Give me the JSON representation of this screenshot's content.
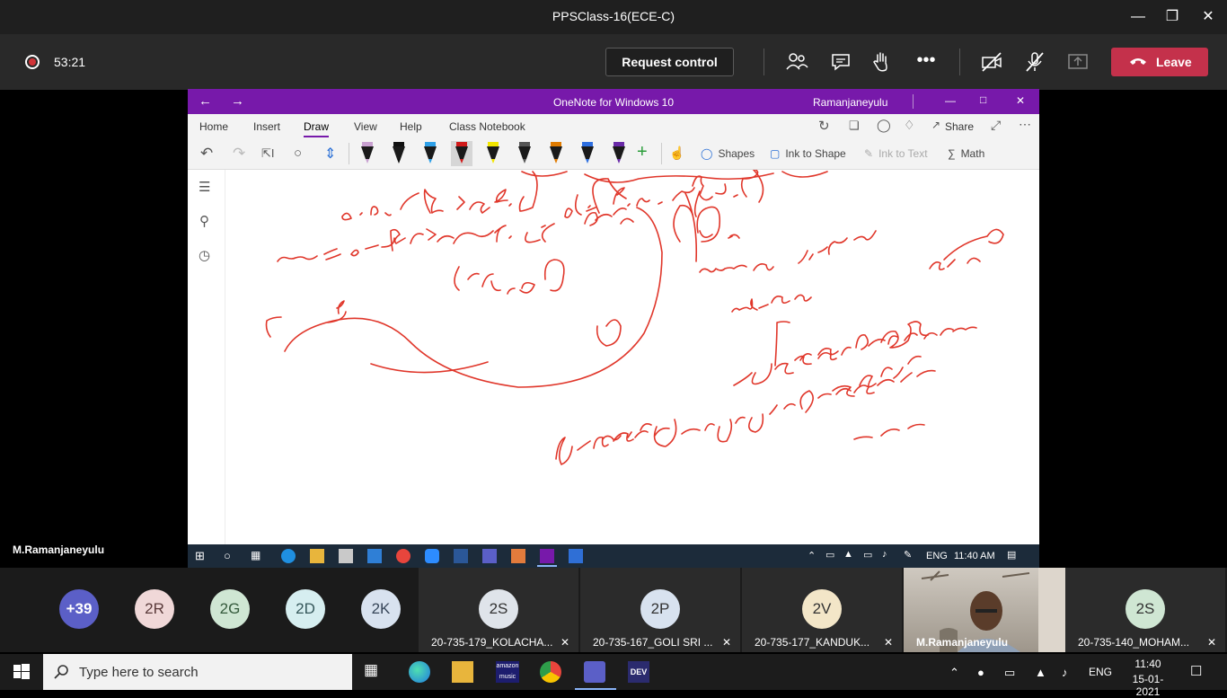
{
  "teams": {
    "window_title": "PPSClass-16(ECE-C)",
    "timer": "53:21",
    "request_control": "Request control",
    "leave": "Leave"
  },
  "onenote": {
    "title": "OneNote for Windows 10",
    "user": "Ramanjaneyulu",
    "tabs": [
      "Home",
      "Insert",
      "Draw",
      "View",
      "Help",
      "Class Notebook"
    ],
    "active_tab": "Draw",
    "share": "Share",
    "tools": {
      "shapes": "Shapes",
      "ink_to_shape": "Ink to Shape",
      "ink_to_text": "Ink to Text",
      "math": "Math"
    },
    "pens": [
      {
        "color": "#c8a0d0"
      },
      {
        "color": "#111111"
      },
      {
        "color": "#2ea0e8"
      },
      {
        "color": "#d11a1a"
      },
      {
        "color": "#f2e600"
      },
      {
        "color": "#555555"
      },
      {
        "color": "#e07b00"
      },
      {
        "color": "#2e6fe0"
      },
      {
        "color": "#6a2aa8"
      }
    ],
    "ink_color": "#e0362a"
  },
  "inner_taskbar": {
    "lang": "ENG",
    "time": "11:40 AM"
  },
  "presenter": "M.Ramanjaneyulu",
  "participants": {
    "overflow": [
      {
        "label": "+39",
        "bg": "#5b5fc7",
        "fg": "#ffffff"
      },
      {
        "label": "2R",
        "bg": "#f0d8d8",
        "fg": "#5a3a3a"
      },
      {
        "label": "2G",
        "bg": "#cfe6d3",
        "fg": "#355a3c"
      },
      {
        "label": "2D",
        "bg": "#d6eef0",
        "fg": "#35575a"
      },
      {
        "label": "2K",
        "bg": "#d8e2ef",
        "fg": "#38475a"
      }
    ],
    "tiles": [
      {
        "initials": "2S",
        "name": "20-735-179_KOLACHA...",
        "bg": "#dfe4ea"
      },
      {
        "initials": "2P",
        "name": "20-735-167_GOLI SRI ...",
        "bg": "#d8e2ef"
      },
      {
        "initials": "2V",
        "name": "20-735-177_KANDUK...",
        "bg": "#f3e6c8"
      },
      {
        "initials": "2S",
        "name": "20-735-140_MOHAM...",
        "bg": "#cfe6d3"
      }
    ],
    "video_name": "M.Ramanjaneyulu"
  },
  "taskbar": {
    "search_placeholder": "Type here to search",
    "lang": "ENG",
    "time": "11:40",
    "date": "15-01-2021"
  }
}
